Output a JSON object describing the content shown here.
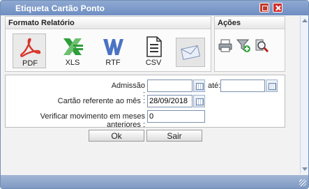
{
  "window": {
    "title": "Etiqueta Cartão Ponto"
  },
  "formats": {
    "header": "Formato Relatório",
    "items": [
      {
        "label": "PDF",
        "icon": "pdf-icon",
        "color": "#d9342b"
      },
      {
        "label": "XLS",
        "icon": "xls-icon",
        "color": "#2e9e3a"
      },
      {
        "label": "RTF",
        "icon": "rtf-icon",
        "color": "#4b73c4"
      },
      {
        "label": "CSV",
        "icon": "csv-icon",
        "color": "#333333"
      }
    ],
    "email_icon": "email-icon"
  },
  "actions": {
    "header": "Ações",
    "icons": [
      "printer-icon",
      "filter-add-icon",
      "search-icon"
    ]
  },
  "form": {
    "admissao_label": "Admissão :",
    "ate_label": "até:",
    "admissao_from": "",
    "admissao_to": "",
    "cartao_label": "Cartão referente ao mês :",
    "cartao_value": "28/09/2018",
    "verificar_label": "Verificar movimento em meses anteriores :",
    "verificar_value": "0"
  },
  "buttons": {
    "ok": "Ok",
    "sair": "Sair"
  },
  "colors": {
    "titlebar": "#7b97c8",
    "accent_blue": "#6f8fb7"
  }
}
